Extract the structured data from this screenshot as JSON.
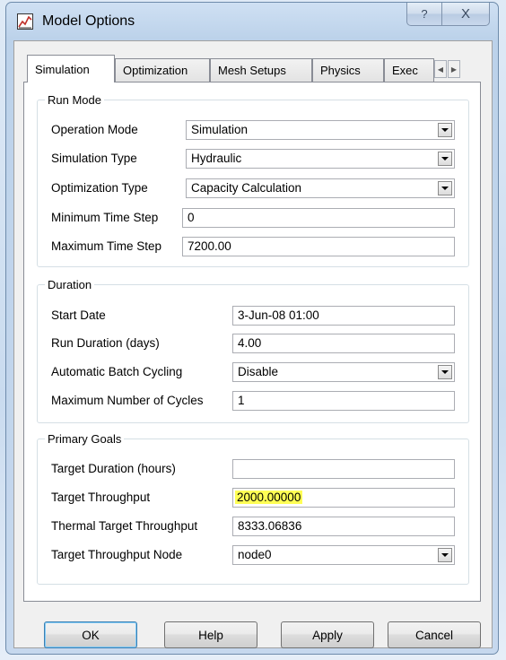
{
  "window": {
    "title": "Model Options",
    "help_glyph": "?",
    "close_glyph": "X"
  },
  "tabs": [
    {
      "label": "Simulation"
    },
    {
      "label": "Optimization"
    },
    {
      "label": "Mesh Setups"
    },
    {
      "label": "Physics"
    },
    {
      "label": "Exec"
    }
  ],
  "tab_scroll": {
    "left": "◀",
    "right": "▶"
  },
  "run_mode": {
    "title": "Run Mode",
    "operation_mode": {
      "label": "Operation Mode",
      "value": "Simulation"
    },
    "simulation_type": {
      "label": "Simulation Type",
      "value": "Hydraulic"
    },
    "optimization_type": {
      "label": "Optimization Type",
      "value": "Capacity Calculation"
    },
    "min_time_step": {
      "label": "Minimum Time Step",
      "value": "0"
    },
    "max_time_step": {
      "label": "Maximum Time Step",
      "value": "7200.00"
    }
  },
  "duration": {
    "title": "Duration",
    "start_date": {
      "label": "Start Date",
      "value": "3-Jun-08 01:00"
    },
    "run_duration": {
      "label": "Run Duration (days)",
      "value": "4.00"
    },
    "batch_cycling": {
      "label": "Automatic Batch Cycling",
      "value": "Disable"
    },
    "max_cycles": {
      "label": "Maximum Number of Cycles",
      "value": "1"
    }
  },
  "primary_goals": {
    "title": "Primary Goals",
    "target_duration": {
      "label": "Target Duration (hours)",
      "value": ""
    },
    "target_throughput": {
      "label": "Target Throughput",
      "value": "2000.00000"
    },
    "thermal_throughput": {
      "label": "Thermal Target Throughput",
      "value": "8333.06836"
    },
    "throughput_node": {
      "label": "Target Throughput Node",
      "value": "node0"
    }
  },
  "buttons": {
    "ok": "OK",
    "help": "Help",
    "apply": "Apply",
    "cancel": "Cancel"
  },
  "colors": {
    "highlight": "#ffff55",
    "titlebar": "#c6d8ee"
  }
}
